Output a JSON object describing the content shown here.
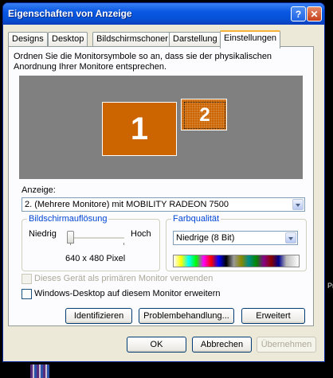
{
  "window": {
    "title": "Eigenschaften von Anzeige",
    "help_glyph": "?",
    "close_glyph": "✕"
  },
  "tabs": [
    {
      "label": "Designs",
      "active": false
    },
    {
      "label": "Desktop",
      "active": false
    },
    {
      "label": "Bildschirmschoner",
      "active": false
    },
    {
      "label": "Darstellung",
      "active": false
    },
    {
      "label": "Einstellungen",
      "active": true
    }
  ],
  "instructions": "Ordnen Sie die Monitorsymbole so an, dass sie der physikalischen Anordnung Ihrer Monitore entsprechen.",
  "monitors": [
    {
      "number": "1"
    },
    {
      "number": "2"
    }
  ],
  "display": {
    "label": "Anzeige:",
    "selected": "2. (Mehrere Monitore) mit MOBILITY RADEON 7500"
  },
  "resolution": {
    "group_title": "Bildschirmauflösung",
    "low_label": "Niedrig",
    "high_label": "Hoch",
    "value_text": "640 x 480 Pixel",
    "slider_fraction": 0.0
  },
  "color_quality": {
    "group_title": "Farbqualität",
    "selected": "Niedrige (8 Bit)"
  },
  "options": {
    "primary_monitor": "Dieses Gerät als primären Monitor verwenden",
    "extend_desktop": "Windows-Desktop auf diesem Monitor erweitern"
  },
  "buttons": {
    "identify": "Identifizieren",
    "troubleshoot": "Problembehandlung...",
    "advanced": "Erweitert",
    "ok": "OK",
    "cancel": "Abbrechen",
    "apply": "Übernehmen"
  },
  "desktop": {
    "partial_text": "Pr"
  },
  "colors": {
    "titlebar": "#0653d8",
    "monitor": "#cc6400",
    "monitor_area": "#808080",
    "dialog": "#ece9d8"
  }
}
